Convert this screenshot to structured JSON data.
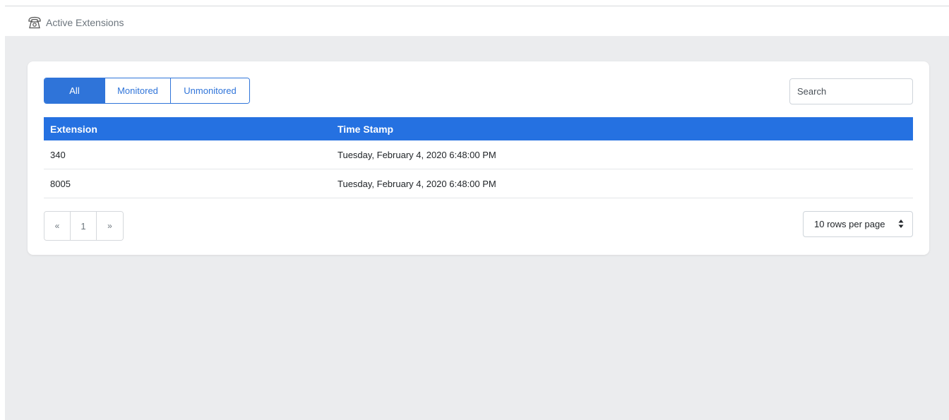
{
  "header": {
    "icon": "phone-icon",
    "title": "Active Extensions"
  },
  "filters": {
    "tabs": [
      {
        "label": "All",
        "active": true
      },
      {
        "label": "Monitored",
        "active": false
      },
      {
        "label": "Unmonitored",
        "active": false
      }
    ]
  },
  "search": {
    "placeholder": "Search",
    "value": ""
  },
  "table": {
    "columns": [
      "Extension",
      "Time Stamp"
    ],
    "rows": [
      {
        "extension": "340",
        "timestamp": "Tuesday, February 4, 2020 6:48:00 PM"
      },
      {
        "extension": "8005",
        "timestamp": "Tuesday, February 4, 2020 6:48:00 PM"
      }
    ]
  },
  "pagination": {
    "prev": "«",
    "current": "1",
    "next": "»"
  },
  "page_size": {
    "selected": "10 rows per page",
    "icon": "sort-arrows-icon"
  },
  "colors": {
    "accent": "#2f74d9",
    "table_header": "#2571e1",
    "background": "#ebecee"
  }
}
